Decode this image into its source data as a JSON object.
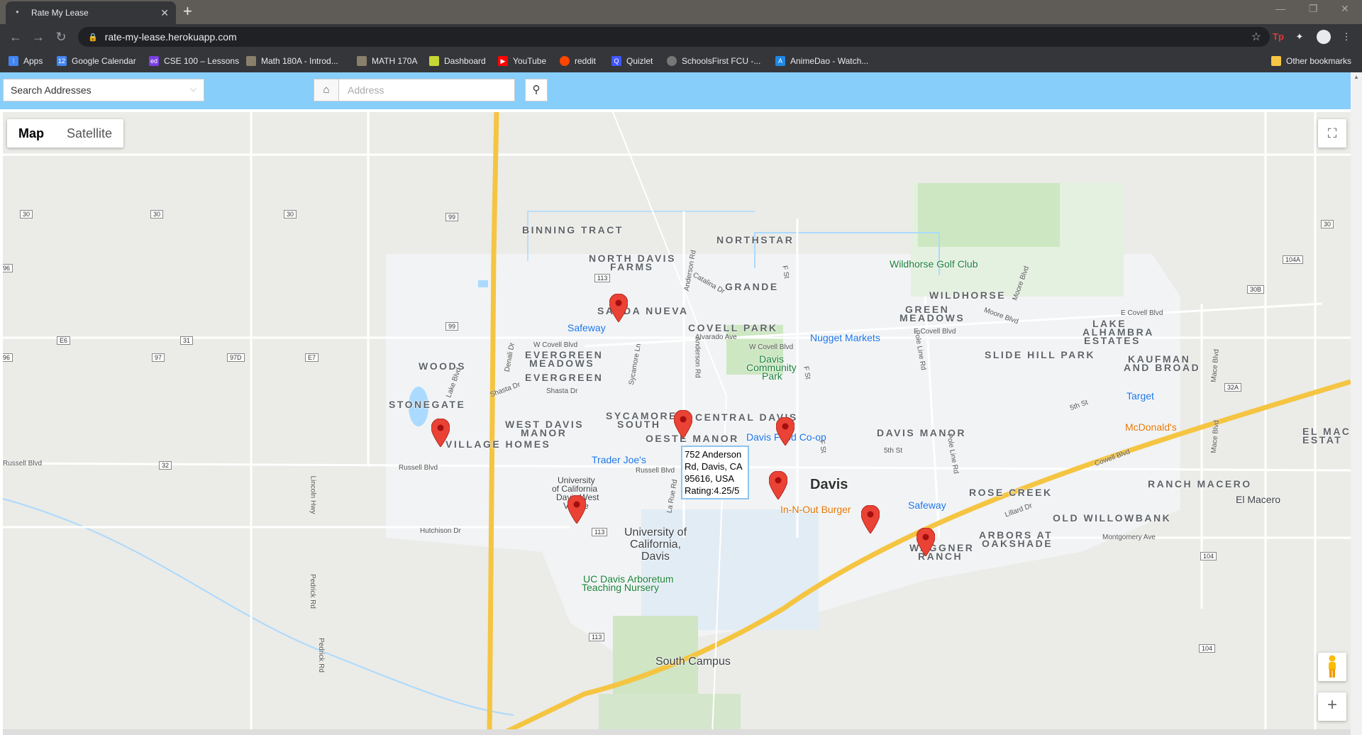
{
  "browser": {
    "tab_title": "Rate My Lease",
    "url": "rate-my-lease.herokuapp.com",
    "bookmarks": [
      "Apps",
      "Google Calendar",
      "CSE 100 – Lessons",
      "Math 180A - Introd...",
      "MATH 170A",
      "Dashboard",
      "YouTube",
      "reddit",
      "Quizlet",
      "SchoolsFirst FCU -...",
      "AnimeDao - Watch..."
    ],
    "other_bookmarks": "Other bookmarks"
  },
  "search": {
    "select_label": "Search Addresses",
    "address_placeholder": "Address"
  },
  "map": {
    "map_type": [
      "Map",
      "Satellite"
    ],
    "areas": [
      "BINNING TRACT",
      "NORTHSTAR",
      "NORTH DAVIS",
      "FARMS",
      "GRANDE",
      "SANDA NUEVA",
      "WILDHORSE",
      "GREEN",
      "MEADOWS",
      "COVELL PARK",
      "LAKE",
      "ALHAMBRA",
      "ESTATES",
      "WOODS",
      "EVERGREEN",
      "MEADOWS",
      "EVERGREEN",
      "SLIDE HILL PARK",
      "KAUFMAN",
      "AND BROAD",
      "STONEGATE",
      "SYCAMORE",
      "SOUTH",
      "CENTRAL DAVIS",
      "WEST DAVIS",
      "MANOR",
      "DAVIS MANOR",
      "VILLAGE HOMES",
      "OESTE MANOR",
      "EL MAC",
      "ESTAT",
      "ROSE CREEK",
      "RANCH MACERO",
      "OLD WILLOWBANK",
      "ARBORS AT",
      "OAKSHADE",
      "WAGGNER",
      "RANCH"
    ],
    "pois": [
      "Safeway",
      "Nugget Markets",
      "Wildhorse Golf Club",
      "Davis",
      "Community",
      "Park",
      "Target",
      "McDonald's",
      "Davis Food Co-op",
      "Trader Joe's",
      "University",
      "of California",
      "Davis West",
      "Village",
      "In-N-Out Burger",
      "Safeway",
      "El Macero",
      "UC Davis Arboretum",
      "Teaching Nursery",
      "South Campus"
    ],
    "city": "Davis",
    "university": [
      "University of",
      "California,",
      "Davis"
    ],
    "roads": [
      "W Covell Blvd",
      "E Covell Blvd",
      "Alvarado Ave",
      "Russell Blvd",
      "Hutchison Dr",
      "Anderson Rd",
      "Sycamore Ln",
      "Lake Blvd",
      "Shasta Dr",
      "Denali Dr",
      "5th St",
      "Pole Line Rd",
      "F St",
      "Mace Blvd",
      "Cowell Blvd",
      "Montgomery Ave",
      "Lillard Dr",
      "Moore Blvd",
      "La Rue Rd",
      "Lincoln Hwy",
      "Pedrick Rd",
      "Catalina Dr"
    ],
    "shields": [
      "30",
      "30",
      "30",
      "99",
      "113",
      "99",
      "E6",
      "31",
      "97",
      "97D",
      "E7",
      "96",
      "96",
      "32",
      "104A",
      "30B",
      "30",
      "32A",
      "104",
      "104",
      "113",
      "113"
    ],
    "infobox": {
      "line1": "752 Anderson",
      "line2": "Rd, Davis, CA",
      "line3": "95616, USA",
      "line4": "Rating:4.25/5"
    },
    "marker_color": "#ea4335"
  }
}
